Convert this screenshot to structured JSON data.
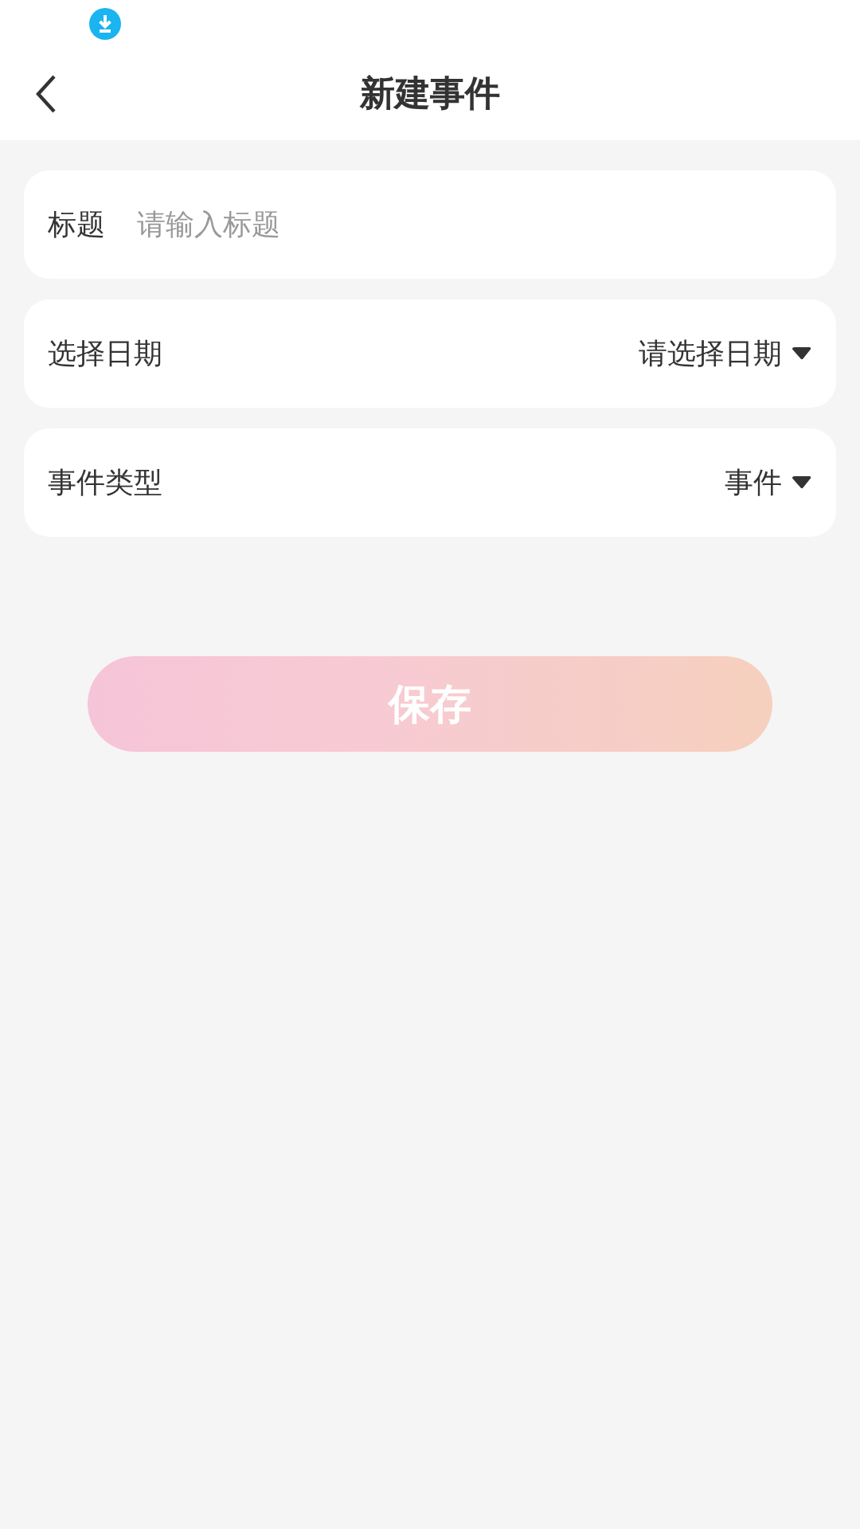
{
  "header": {
    "title": "新建事件"
  },
  "fields": [
    {
      "kind": "input",
      "label": "标题",
      "placeholder": "请输入标题"
    },
    {
      "kind": "select",
      "label": "选择日期",
      "value": "请选择日期"
    },
    {
      "kind": "select",
      "label": "事件类型",
      "value": "事件"
    }
  ],
  "save_button": {
    "label": "保存"
  }
}
